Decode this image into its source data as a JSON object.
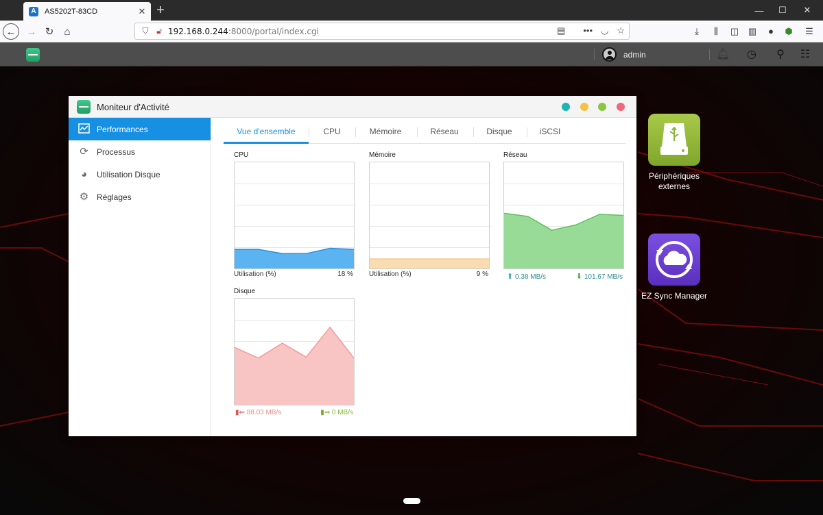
{
  "browser": {
    "tab_title": "AS5202T-83CD",
    "tab_close": "✕",
    "new_tab": "+",
    "url_host": "192.168.0.244",
    "url_path": ":8000/portal/index.cgi",
    "window_controls": {
      "minimize": "—",
      "maximize": "☐",
      "close": "✕"
    }
  },
  "desktop": {
    "user": "admin",
    "icons": [
      {
        "label": "Périphériques externes",
        "color": "#8db53a",
        "icon": "usb-drive-icon"
      },
      {
        "label": "EZ Sync Manager",
        "color": "#6a3dd6",
        "icon": "cloud-sync-icon"
      }
    ]
  },
  "window": {
    "title": "Moniteur d'Activité",
    "controls": [
      {
        "name": "teal",
        "color": "#1fb3b3"
      },
      {
        "name": "yellow",
        "color": "#f5c242"
      },
      {
        "name": "green",
        "color": "#8cc63f"
      },
      {
        "name": "red",
        "color": "#f0667a"
      }
    ],
    "sidebar": [
      {
        "label": "Performances",
        "icon": "performance-chart-icon",
        "active": true
      },
      {
        "label": "Processus",
        "icon": "process-cycle-icon",
        "active": false
      },
      {
        "label": "Utilisation Disque",
        "icon": "disk-usage-icon",
        "active": false
      },
      {
        "label": "Réglages",
        "icon": "gear-icon",
        "active": false
      }
    ],
    "tabs": [
      {
        "label": "Vue d'ensemble",
        "active": true
      },
      {
        "label": "CPU",
        "active": false
      },
      {
        "label": "Mémoire",
        "active": false
      },
      {
        "label": "Réseau",
        "active": false
      },
      {
        "label": "Disque",
        "active": false
      },
      {
        "label": "iSCSI",
        "active": false
      }
    ],
    "panels": {
      "cpu": {
        "title": "CPU",
        "stat_label": "Utilisation (%)",
        "stat_value": "18 %"
      },
      "memory": {
        "title": "Mémoire",
        "stat_label": "Utilisation (%)",
        "stat_value": "9 %"
      },
      "network": {
        "title": "Réseau",
        "upload": "0.38 MB/s",
        "download": "101.67 MB/s"
      },
      "disk": {
        "title": "Disque",
        "read": "88.03 MB/s",
        "write": "0 MB/s"
      }
    }
  },
  "chart_data": [
    {
      "type": "area",
      "title": "CPU",
      "ylim": [
        0,
        100
      ],
      "series": [
        {
          "values": [
            18,
            18,
            14,
            14,
            19,
            18
          ],
          "color": "#5bb3f2",
          "line": "#2a8fd8"
        }
      ]
    },
    {
      "type": "area",
      "title": "Mémoire",
      "ylim": [
        0,
        100
      ],
      "series": [
        {
          "values": [
            9,
            9,
            9,
            9,
            9,
            9
          ],
          "color": "#fbdcb0",
          "line": "#f4c98a"
        }
      ]
    },
    {
      "type": "area",
      "title": "Réseau",
      "ylim": [
        0,
        100
      ],
      "series": [
        {
          "values": [
            52,
            49,
            36,
            41,
            51,
            50
          ],
          "color": "#97db97",
          "line": "#5fbf5f"
        }
      ]
    },
    {
      "type": "area",
      "title": "Disque",
      "ylim": [
        0,
        100
      ],
      "series": [
        {
          "values": [
            54,
            44,
            58,
            45,
            73,
            44
          ],
          "color": "#f9c4c4",
          "line": "#f29a9a"
        }
      ]
    }
  ]
}
